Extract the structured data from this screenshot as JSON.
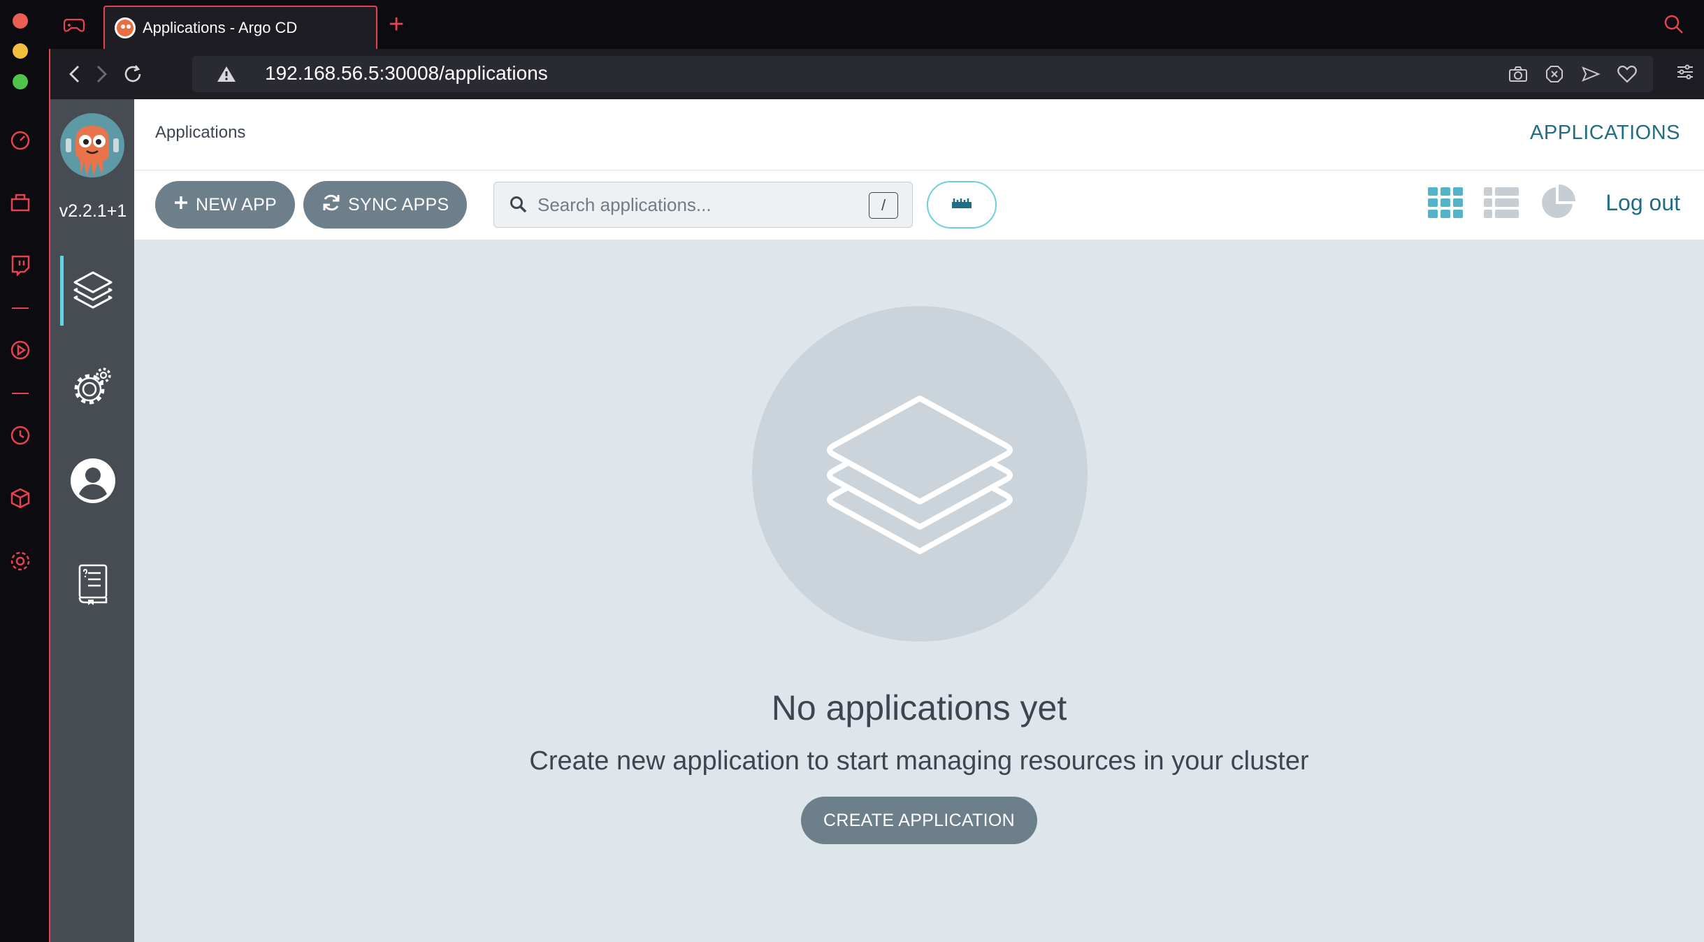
{
  "browser": {
    "tab_title": "Applications - Argo CD",
    "new_tab": "+",
    "url": "192.168.56.5:30008/applications",
    "accent": "#e8414f"
  },
  "sidebar": {
    "version": "v2.2.1+1",
    "items": [
      {
        "name": "applications",
        "icon": "layers-icon",
        "active": true
      },
      {
        "name": "settings",
        "icon": "gears-icon",
        "active": false
      },
      {
        "name": "user-info",
        "icon": "user-icon",
        "active": false
      },
      {
        "name": "documentation",
        "icon": "book-icon",
        "active": false
      }
    ]
  },
  "header": {
    "breadcrumb": "Applications",
    "title": "APPLICATIONS"
  },
  "toolbar": {
    "new_app_label": "NEW APP",
    "sync_apps_label": "SYNC APPS",
    "search_placeholder": "Search applications...",
    "search_shortcut": "/",
    "logout_label": "Log out",
    "views": [
      "tiles-view-icon",
      "list-view-icon",
      "summary-pie-icon"
    ],
    "active_view": "tiles"
  },
  "empty_state": {
    "title": "No applications yet",
    "subtitle": "Create new application to start managing resources in your cluster",
    "button_label": "CREATE APPLICATION"
  },
  "colors": {
    "brand_teal": "#1f6e85",
    "active_cyan": "#6bcfdc",
    "button_gray": "#6d7f8b",
    "main_bg": "#dee6eb"
  }
}
